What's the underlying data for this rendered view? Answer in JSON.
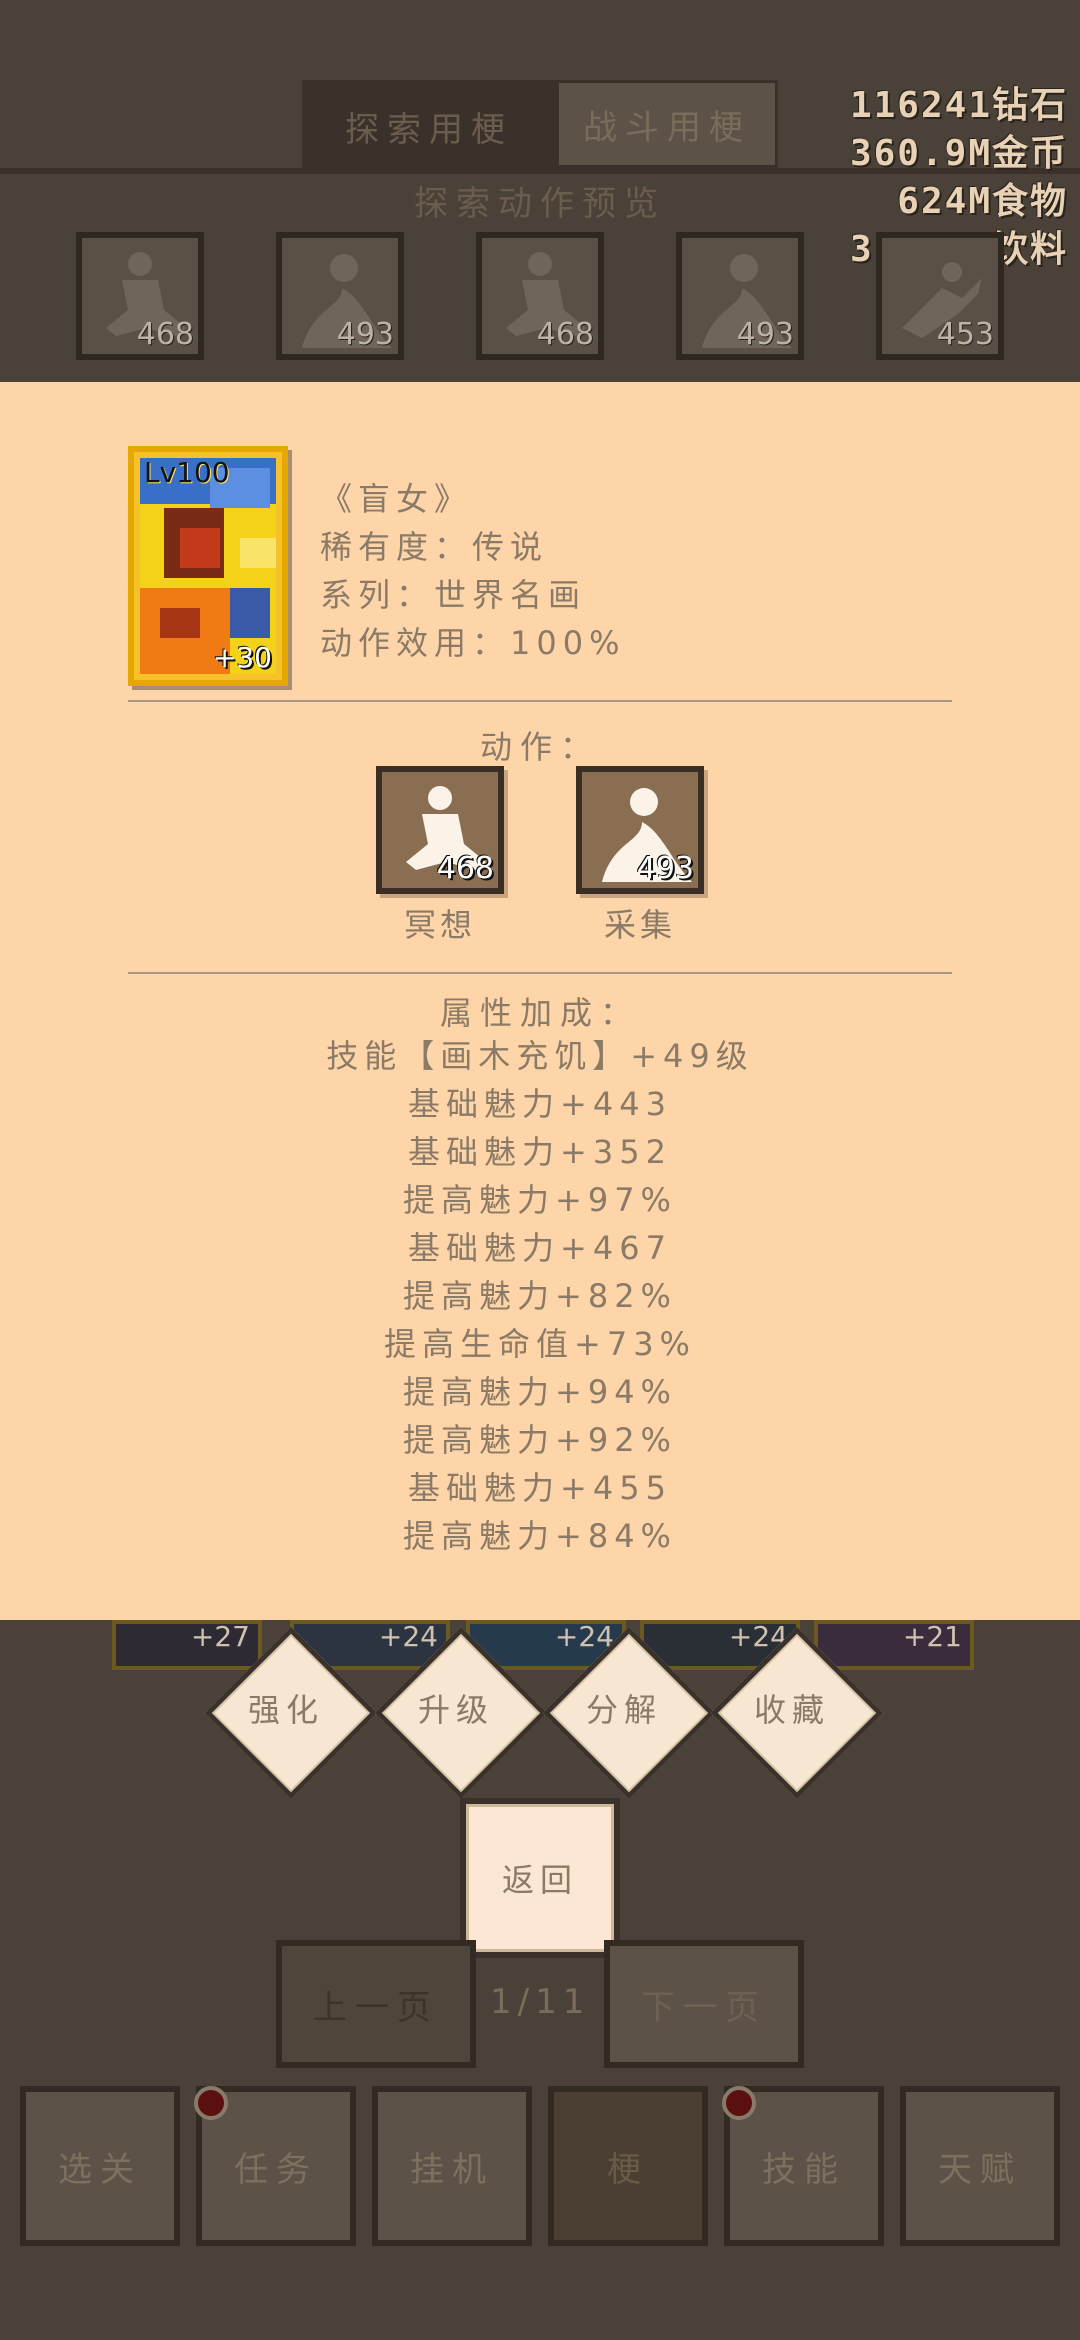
{
  "tabs": {
    "explore": "探索用梗",
    "battle": "战斗用梗"
  },
  "resources": [
    "116241钻石",
    "360.9M金币",
    "624M食物",
    "316.3M饮料"
  ],
  "preview": {
    "title": "探索动作预览",
    "slots": [
      {
        "icon": "meditate-icon",
        "count": "468",
        "label": "冥想"
      },
      {
        "icon": "gather-icon",
        "count": "493",
        "label": "采集"
      },
      {
        "icon": "meditate-icon",
        "count": "468",
        "label": "冥想"
      },
      {
        "icon": "gather-icon",
        "count": "493",
        "label": "采集"
      },
      {
        "icon": "pose-icon",
        "count": "453",
        "label": "瑜伽"
      }
    ]
  },
  "card_strip": [
    "+27",
    "+24",
    "+24",
    "+24",
    "+21"
  ],
  "ops": {
    "enhance": "强化",
    "upgrade": "升级",
    "decompose": "分解",
    "favorite": "收藏"
  },
  "back_label": "返回",
  "pager": {
    "prev": "上一页",
    "indicator": "1/11",
    "next": "下一页"
  },
  "nav": {
    "stage": "选关",
    "quest": "任务",
    "idle": "挂机",
    "meme": "梗",
    "skill": "技能",
    "talent": "天赋"
  },
  "detail": {
    "card": {
      "level": "Lv100",
      "plus": "+30"
    },
    "name": "《盲女》",
    "rarity": "稀有度：传说",
    "series": "系列：世界名画",
    "efficiency": "动作效用：100%",
    "actions_title": "动作：",
    "actions": [
      {
        "icon": "meditate-icon",
        "count": "468",
        "label": "冥想"
      },
      {
        "icon": "gather-icon",
        "count": "493",
        "label": "采集"
      }
    ],
    "attr_title": "属性加成：",
    "attrs": [
      "技能【画木充饥】+49级",
      "基础魅力+443",
      "基础魅力+352",
      "提高魅力+97%",
      "基础魅力+467",
      "提高魅力+82%",
      "提高生命值+73%",
      "提高魅力+94%",
      "提高魅力+92%",
      "基础魅力+455",
      "提高魅力+84%"
    ]
  },
  "colors": {
    "modal_bg": "#fed5a9",
    "page_bg": "#4a4138",
    "text": "#8a7a66",
    "card_gold": "#f6c22a"
  }
}
